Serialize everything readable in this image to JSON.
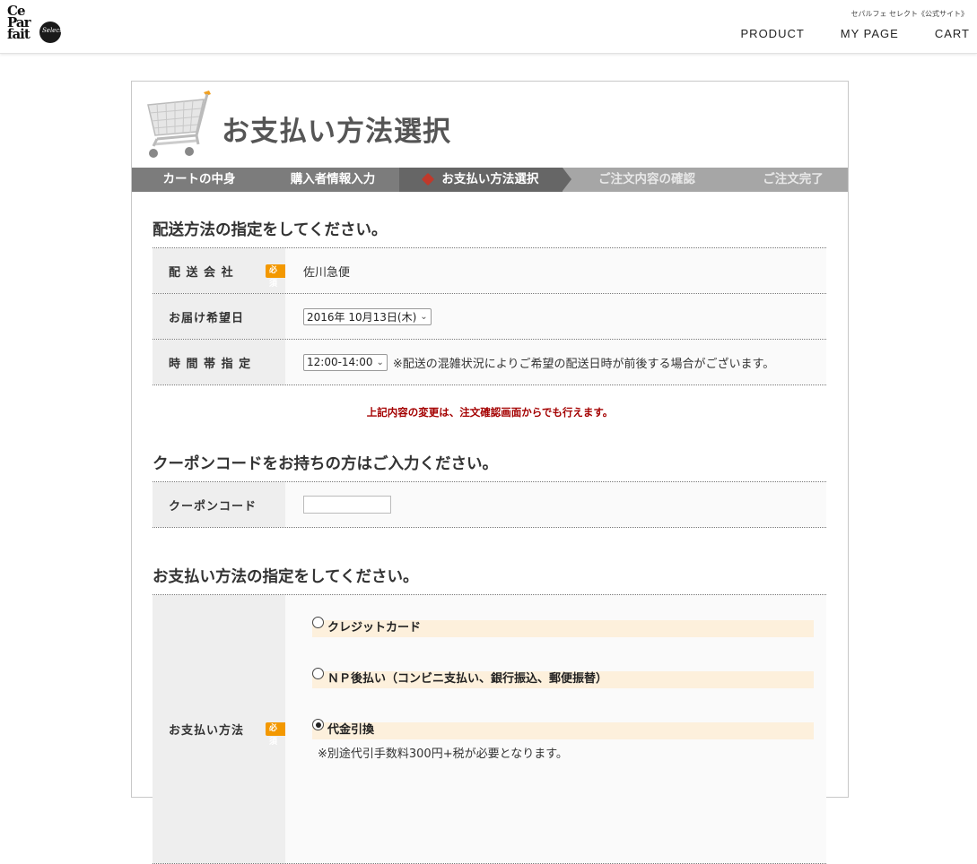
{
  "header": {
    "logo_line1": "Ce",
    "logo_line2": "Par",
    "logo_line3": "fait",
    "logo_sub": "Select",
    "site_tag": "セパルフェ セレクト《公式サイト》",
    "nav": [
      "PRODUCT",
      "MY PAGE",
      "CART"
    ]
  },
  "page": {
    "title": "お支払い方法選択"
  },
  "steps": [
    {
      "label": "カートの中身",
      "state": "done"
    },
    {
      "label": "購入者情報入力",
      "state": "done"
    },
    {
      "label": "お支払い方法選択",
      "state": "current"
    },
    {
      "label": "ご注文内容の確認",
      "state": "todo"
    },
    {
      "label": "ご注文完了",
      "state": "todo"
    }
  ],
  "delivery": {
    "title": "配送方法の指定をしてください。",
    "rows": {
      "company_label": "配 送 会 社",
      "company_value": "佐川急便",
      "date_label": "お届け希望日",
      "date_value": "2016年 10月13日(木)",
      "time_label": "時 間 帯 指 定",
      "time_value": "12:00-14:00",
      "time_note": "※配送の混雑状況によりご希望の配送日時が前後する場合がございます。"
    },
    "required_badge": "必須",
    "notice": "上記内容の変更は、注文確認画面からでも行えます。"
  },
  "coupon": {
    "title": "クーポンコードをお持ちの方はご入力ください。",
    "label": "クーポンコード",
    "value": ""
  },
  "payment": {
    "title": "お支払い方法の指定をしてください。",
    "label": "お支払い方法",
    "options": [
      {
        "label": "クレジットカード",
        "selected": false
      },
      {
        "label": "ＮＰ後払い（コンビニ支払い、銀行振込、郵便振替）",
        "selected": false
      },
      {
        "label": "代金引換",
        "selected": true,
        "note": "※別途代引手数料300円+税が必要となります。"
      }
    ]
  },
  "colors": {
    "required": "#f39800",
    "notice": "#a40000",
    "option_bg": "#fdf0dc"
  }
}
